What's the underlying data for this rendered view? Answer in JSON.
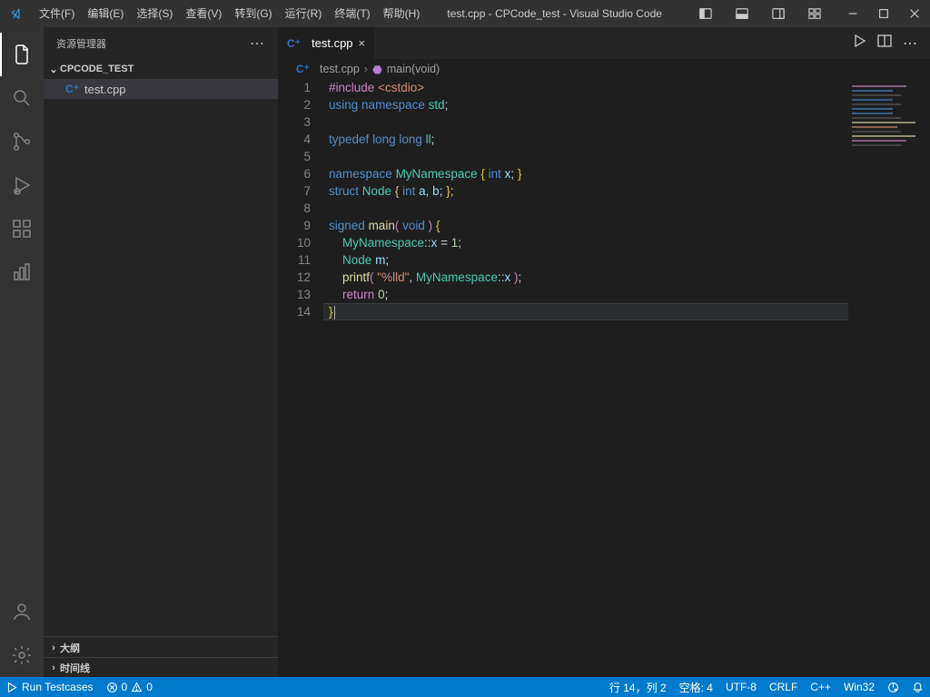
{
  "titlebar": {
    "menu": [
      "文件(F)",
      "编辑(E)",
      "选择(S)",
      "查看(V)",
      "转到(G)",
      "运行(R)",
      "终端(T)",
      "帮助(H)"
    ],
    "title": "test.cpp - CPCode_test - Visual Studio Code"
  },
  "explorer": {
    "title": "资源管理器",
    "project": "CPCODE_TEST",
    "files": [
      {
        "icon": "C⁺",
        "name": "test.cpp",
        "active": true
      }
    ],
    "outline": "大纲",
    "timeline": "时间线"
  },
  "tabs": {
    "active": {
      "icon": "C⁺",
      "name": "test.cpp"
    }
  },
  "breadcrumb": {
    "file": "test.cpp",
    "symbol": "main(void)"
  },
  "code": {
    "lines": [
      {
        "n": 1,
        "h": [
          [
            "pp",
            "#include"
          ],
          [
            "punc",
            " "
          ],
          [
            "str",
            "<cstdio>"
          ]
        ]
      },
      {
        "n": 2,
        "h": [
          [
            "type",
            "using"
          ],
          [
            "punc",
            " "
          ],
          [
            "type",
            "namespace"
          ],
          [
            "punc",
            " "
          ],
          [
            "ns",
            "std"
          ],
          [
            "punc",
            ";"
          ]
        ]
      },
      {
        "n": 3,
        "h": []
      },
      {
        "n": 4,
        "h": [
          [
            "type",
            "typedef"
          ],
          [
            "punc",
            " "
          ],
          [
            "type",
            "long long"
          ],
          [
            "punc",
            " "
          ],
          [
            "ns",
            "ll"
          ],
          [
            "punc",
            ";"
          ]
        ]
      },
      {
        "n": 5,
        "h": []
      },
      {
        "n": 6,
        "h": [
          [
            "type",
            "namespace"
          ],
          [
            "punc",
            " "
          ],
          [
            "ns",
            "MyNamespace"
          ],
          [
            "punc",
            " "
          ],
          [
            "bra",
            "{"
          ],
          [
            "punc",
            " "
          ],
          [
            "type",
            "int"
          ],
          [
            "punc",
            " "
          ],
          [
            "var",
            "x"
          ],
          [
            "punc",
            "; "
          ],
          [
            "bra",
            "}"
          ]
        ]
      },
      {
        "n": 7,
        "h": [
          [
            "type",
            "struct"
          ],
          [
            "punc",
            " "
          ],
          [
            "ns",
            "Node"
          ],
          [
            "punc",
            " "
          ],
          [
            "bra",
            "{"
          ],
          [
            "punc",
            " "
          ],
          [
            "type",
            "int"
          ],
          [
            "punc",
            " "
          ],
          [
            "var",
            "a"
          ],
          [
            "punc",
            ", "
          ],
          [
            "var",
            "b"
          ],
          [
            "punc",
            "; "
          ],
          [
            "bra",
            "}"
          ],
          [
            "punc",
            ";"
          ]
        ]
      },
      {
        "n": 8,
        "h": []
      },
      {
        "n": 9,
        "h": [
          [
            "type",
            "signed"
          ],
          [
            "punc",
            " "
          ],
          [
            "fn",
            "main"
          ],
          [
            "bra2",
            "("
          ],
          [
            "punc",
            " "
          ],
          [
            "type",
            "void"
          ],
          [
            "punc",
            " "
          ],
          [
            "bra2",
            ")"
          ],
          [
            "punc",
            " "
          ],
          [
            "bra",
            "{"
          ]
        ]
      },
      {
        "n": 10,
        "h": [
          [
            "punc",
            "    "
          ],
          [
            "ns",
            "MyNamespace"
          ],
          [
            "punc",
            "::"
          ],
          [
            "var",
            "x"
          ],
          [
            "punc",
            " = "
          ],
          [
            "num",
            "1"
          ],
          [
            "punc",
            ";"
          ]
        ]
      },
      {
        "n": 11,
        "h": [
          [
            "punc",
            "    "
          ],
          [
            "ns",
            "Node"
          ],
          [
            "punc",
            " "
          ],
          [
            "var",
            "m"
          ],
          [
            "punc",
            ";"
          ]
        ]
      },
      {
        "n": 12,
        "h": [
          [
            "punc",
            "    "
          ],
          [
            "fn",
            "printf"
          ],
          [
            "bra2",
            "("
          ],
          [
            "punc",
            " "
          ],
          [
            "str",
            "\"%lld\""
          ],
          [
            "punc",
            ", "
          ],
          [
            "ns",
            "MyNamespace"
          ],
          [
            "punc",
            "::"
          ],
          [
            "var",
            "x"
          ],
          [
            "punc",
            " "
          ],
          [
            "bra2",
            ")"
          ],
          [
            "punc",
            ";"
          ]
        ]
      },
      {
        "n": 13,
        "h": [
          [
            "punc",
            "    "
          ],
          [
            "pp",
            "return"
          ],
          [
            "punc",
            " "
          ],
          [
            "num",
            "0"
          ],
          [
            "punc",
            ";"
          ]
        ]
      },
      {
        "n": 14,
        "h": [
          [
            "bra",
            "}"
          ]
        ],
        "cursor": true,
        "hl": true
      }
    ]
  },
  "statusbar": {
    "run": "Run Testcases",
    "err": "0",
    "warn": "0",
    "ln_col": "行 14，列 2",
    "spaces": "空格: 4",
    "encoding": "UTF-8",
    "eol": "CRLF",
    "lang": "C++",
    "win": "Win32"
  }
}
